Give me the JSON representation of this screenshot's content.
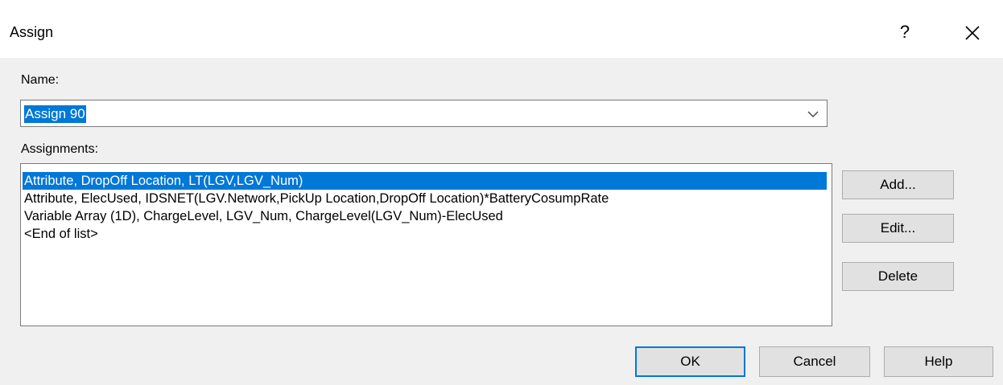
{
  "window": {
    "title": "Assign",
    "help_glyph": "?",
    "close_icon": "close-icon"
  },
  "form": {
    "name_label": "Name:",
    "name_value": "Assign 90",
    "assignments_label": "Assignments:"
  },
  "assignments": [
    "Attribute, DropOff Location, LT(LGV,LGV_Num)",
    "Attribute, ElecUsed, IDSNET(LGV.Network,PickUp Location,DropOff Location)*BatteryCosumpRate",
    "Variable Array (1D), ChargeLevel, LGV_Num, ChargeLevel(LGV_Num)-ElecUsed",
    "<End of list>"
  ],
  "selected_index": 0,
  "side_buttons": {
    "add": "Add...",
    "edit": "Edit...",
    "delete": "Delete"
  },
  "footer_buttons": {
    "ok": "OK",
    "cancel": "Cancel",
    "help": "Help"
  },
  "colors": {
    "selection": "#0078d7",
    "dialog_bg": "#f0f0f0",
    "button_bg": "#e1e1e1"
  }
}
